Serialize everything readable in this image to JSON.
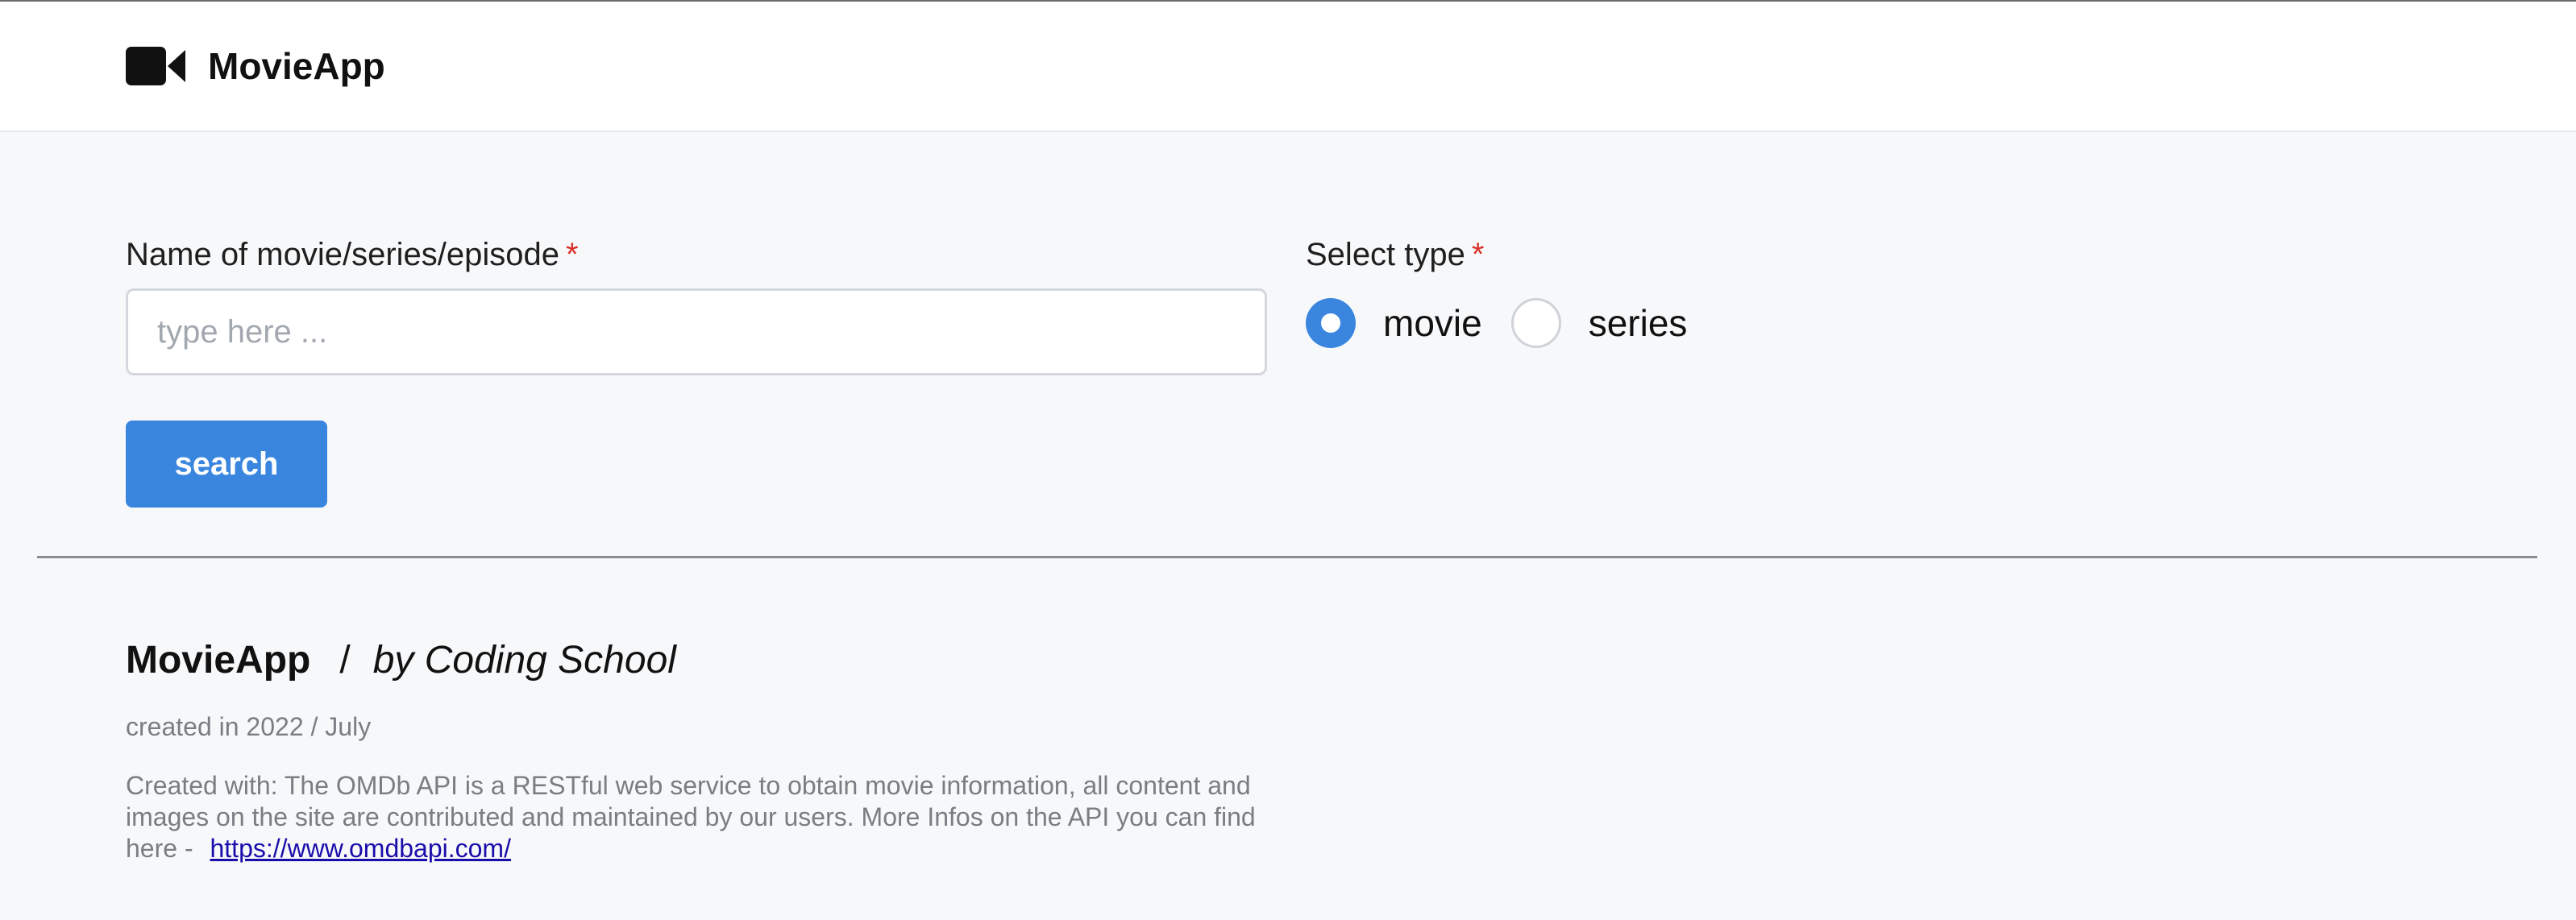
{
  "header": {
    "brand_name": "MovieApp",
    "logo_icon": "video-camera-icon"
  },
  "form": {
    "name_label": "Name of movie/series/episode",
    "required_marker": "*",
    "name_input": {
      "value": "",
      "placeholder": "type here ..."
    },
    "type_label": "Select type",
    "type_options": [
      {
        "label": "movie",
        "checked": true
      },
      {
        "label": "series",
        "checked": false
      }
    ],
    "search_label": "search"
  },
  "footer": {
    "brand": "MovieApp",
    "separator": "/",
    "byline": "by Coding School",
    "created": "created in 2022 / July",
    "description": "Created with: The OMDb API is a RESTful web service to obtain movie information, all content and images on the site are contributed and maintained by our users. More Infos on the API you can find here - ",
    "link_text": "https://www.omdbapi.com/"
  },
  "colors": {
    "accent": "#3a86df",
    "required": "#d93025",
    "link": "#1a0dab",
    "muted_text": "#7a7d82",
    "background": "#f7f8fa"
  }
}
